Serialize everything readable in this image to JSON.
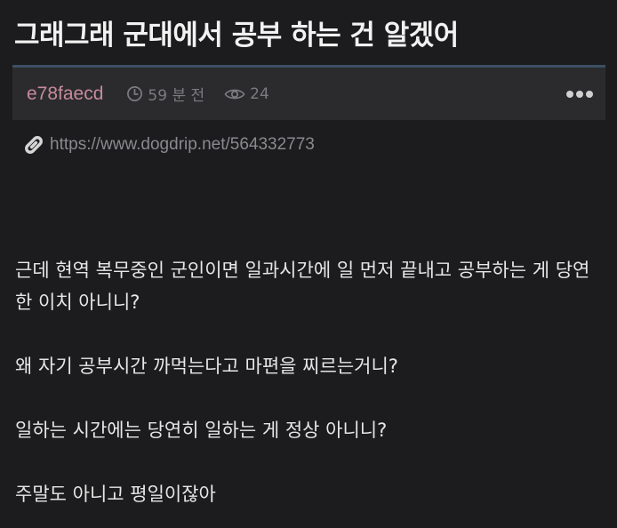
{
  "post": {
    "title": "그래그래 군대에서 공부 하는 건 알겠어",
    "author": "e78faecd",
    "time_ago": "59 분 전",
    "views": "24",
    "link": "https://www.dogdrip.net/564332773",
    "paragraphs": [
      "근데 현역 복무중인 군인이면 일과시간에 일 먼저 끝내고 공부하는 게 당연한 이치 아니니?",
      "왜 자기 공부시간 까먹는다고 마편을 찌르는거니?",
      "일하는 시간에는 당연히 일하는 게 정상 아니니?",
      "주말도 아니고 평일이잖아"
    ]
  },
  "icons": {
    "clock": "clock-icon",
    "views": "eye-icon",
    "link": "link-icon",
    "more": "more-dots-icon"
  },
  "colors": {
    "background": "#1c1c1e",
    "meta_bar": "#2b2b2e",
    "meta_bar_accent": "#3c4f63",
    "author": "#c88a9b",
    "muted": "#7c7c80"
  }
}
